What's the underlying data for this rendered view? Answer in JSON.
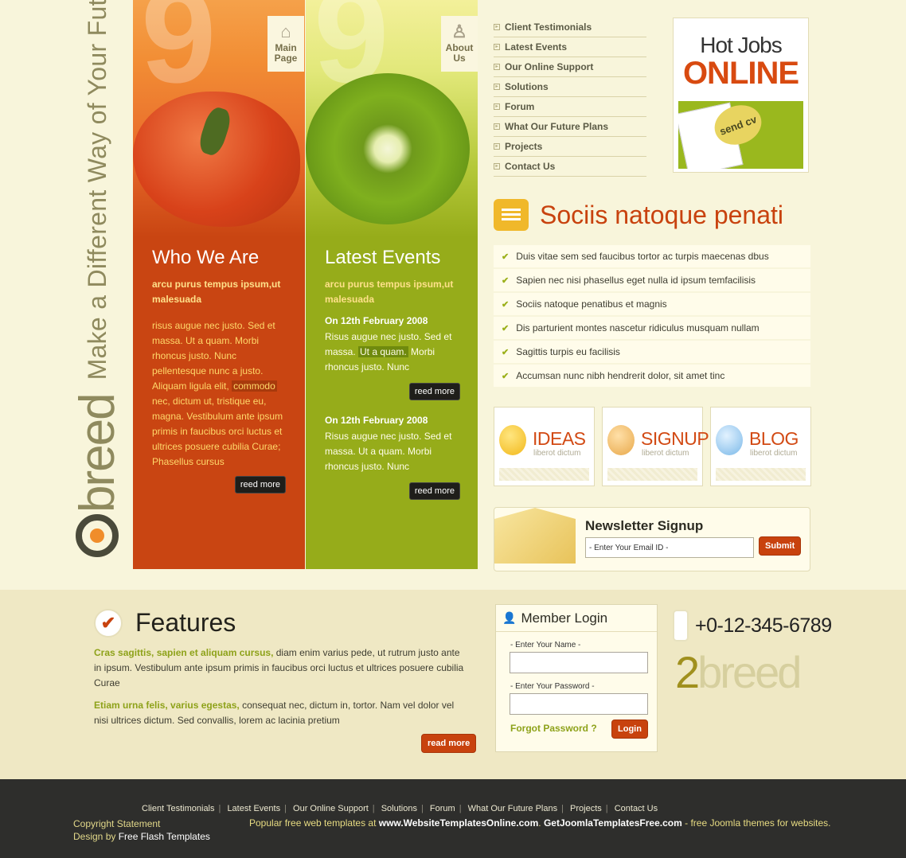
{
  "tagline": "Make a Different Way of Your Future",
  "logo": {
    "part1": "2",
    "part2": "breed"
  },
  "nav_main": {
    "label": "Main Page",
    "l1": "Main",
    "l2": "Page"
  },
  "nav_about": {
    "label": "About Us",
    "l1": "About",
    "l2": "Us"
  },
  "who": {
    "title": "Who We Are",
    "lead": "arcu purus tempus ipsum,ut malesuada",
    "body1": "risus augue nec justo. Sed et massa. Ut a quam. Morbi rhoncus justo. Nunc pellentesque nunc a justo. Aliquam ligula elit, ",
    "highlight": "commodo",
    "body2": " nec, dictum ut, tristique eu, magna. Vestibulum ante ipsum primis in faucibus orci luctus et ultrices posuere cubilia Curae; Phasellus cursus",
    "button": "reed more"
  },
  "events": {
    "title": "Latest Events",
    "lead": "arcu purus tempus ipsum,ut malesuada",
    "items": [
      {
        "date": "On 12th February 2008",
        "pre": "Risus augue nec justo. Sed et massa. ",
        "highlight": "Ut a quam.",
        "post": " Morbi rhoncus justo. Nunc",
        "button": "reed more"
      },
      {
        "date": "On 12th February 2008",
        "pre": "Risus augue nec justo. Sed et massa. Ut a quam. Morbi rhoncus justo. Nunc",
        "highlight": "",
        "post": "",
        "button": "reed more"
      }
    ]
  },
  "menu": [
    "Client Testimonials",
    "Latest Events",
    "Our Online Support",
    "Solutions",
    "Forum",
    "What Our Future Plans",
    "Projects",
    "Contact Us"
  ],
  "hotjobs": {
    "line1": "Hot Jobs",
    "line2": "ONLINE",
    "badge": "send cv"
  },
  "sociis": {
    "title": "Sociis natoque penati",
    "items": [
      "Duis vitae sem sed faucibus tortor ac turpis maecenas dbus",
      "Sapien nec nisi phasellus eget nulla id ipsum temfacilisis",
      "Sociis natoque penatibus et magnis",
      "Dis parturient montes nascetur ridiculus musquam nullam",
      "Sagittis turpis eu facilisis",
      "Accumsan nunc nibh hendrerit dolor, sit amet tinc"
    ]
  },
  "features3": [
    {
      "name": "IDEAS",
      "sub": "liberot dictum"
    },
    {
      "name": "SIGNUP",
      "sub": "liberot dictum"
    },
    {
      "name": "BLOG",
      "sub": "liberot dictum"
    }
  ],
  "newsletter": {
    "title": "Newsletter Signup",
    "placeholder": "- Enter Your Email ID -",
    "button": "Submit"
  },
  "features": {
    "title": "Features",
    "p1_lead": "Cras sagittis, sapien et aliquam cursus,",
    "p1_text": " diam enim varius pede, ut rutrum justo ante in ipsum. Vestibulum ante ipsum primis in faucibus orci luctus et ultrices posuere cubilia Curae",
    "p2_lead": "Etiam urna felis, varius egestas,",
    "p2_text": " consequat nec, dictum in, tortor. Nam vel dolor vel nisi ultrices dictum. Sed convallis, lorem ac lacinia pretium",
    "button": "read more"
  },
  "login": {
    "title": "Member Login",
    "name_label": "- Enter Your Name -",
    "pass_label": "- Enter Your Password -",
    "forgot": "Forgot Password ?",
    "button": "Login"
  },
  "phone": "+0-12-345-6789",
  "brand2": {
    "n": "2",
    "word": "breed"
  },
  "footer": {
    "links": [
      "Client Testimonials",
      "Latest Events",
      "Our Online Support",
      "Solutions",
      "Forum",
      "What Our Future Plans",
      "Projects",
      "Contact Us"
    ],
    "copyright": "Copyright Statement",
    "design_pre": "Design by ",
    "design_link": "Free Flash Templates",
    "mid_pre": "Popular free web templates at ",
    "mid_link1": "www.WebsiteTemplatesOnline.com",
    "mid_sep": ". ",
    "mid_link2": "GetJoomlaTemplatesFree.com",
    "mid_post": " - free Joomla themes for websites."
  },
  "colors": {
    "accent_orange": "#c94512",
    "accent_green": "#96ac1a",
    "bg": "#f8f5db",
    "footer": "#2e2e2c"
  }
}
